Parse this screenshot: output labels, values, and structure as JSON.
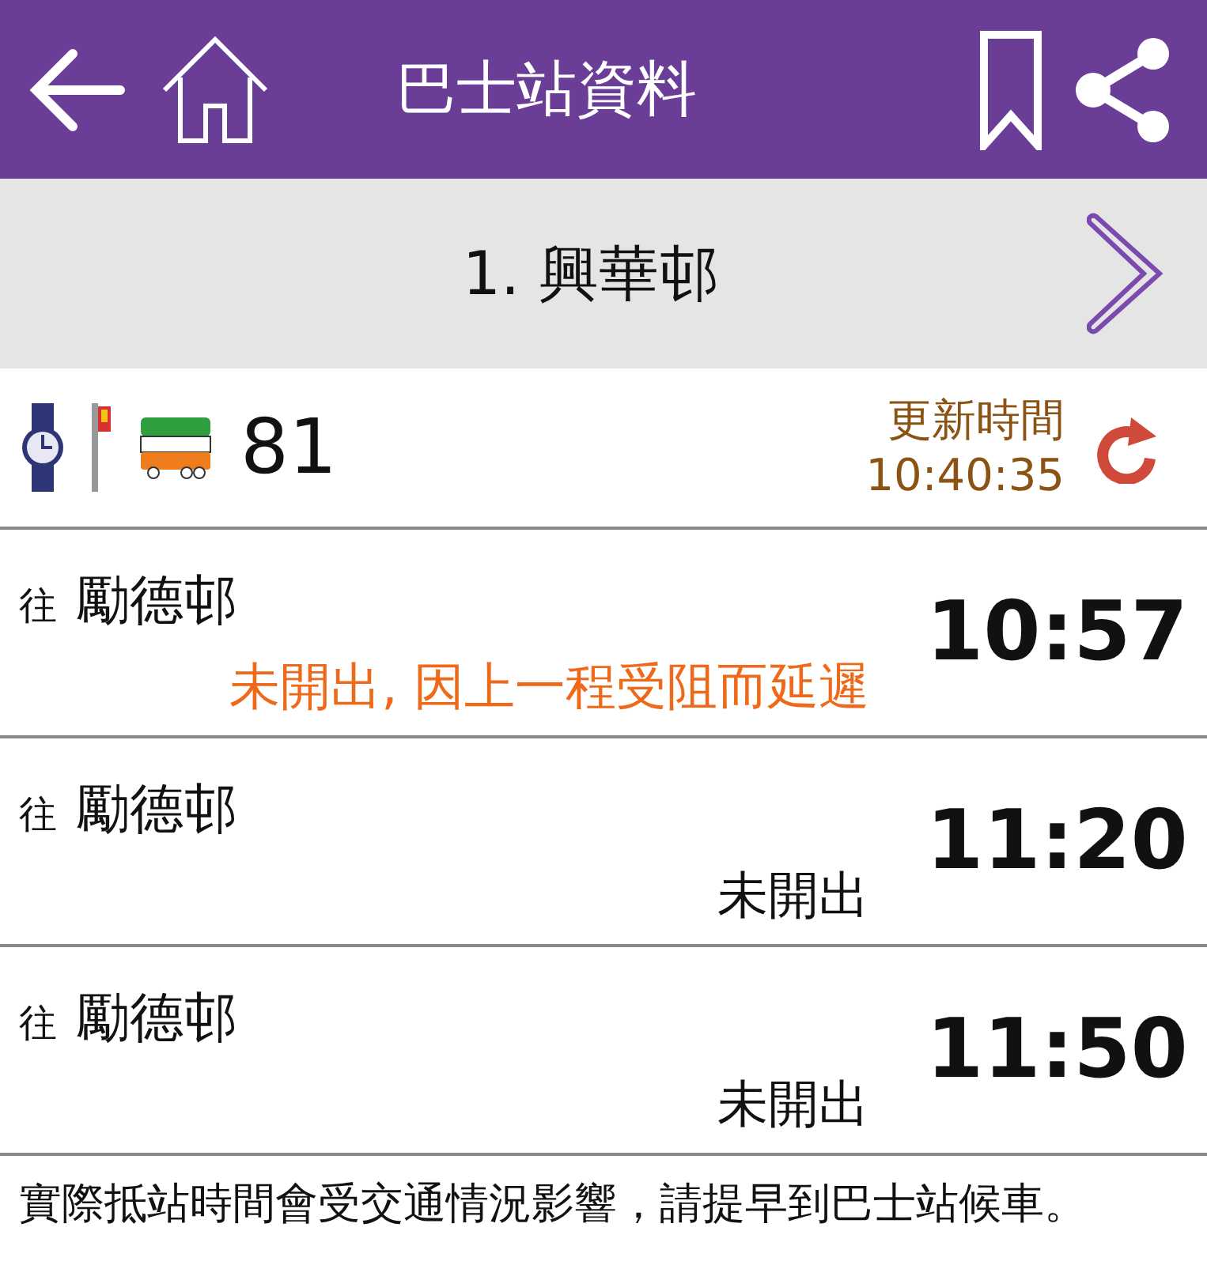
{
  "app_bar": {
    "title": "巴士站資料"
  },
  "stop": {
    "name": "1. 興華邨"
  },
  "route": {
    "number": "81",
    "update_label": "更新時間",
    "update_time": "10:40:35"
  },
  "departures": [
    {
      "prefix": "往",
      "destination": "勵德邨",
      "status": "未開出, 因上一程受阻而延遲",
      "kind": "delayed",
      "time": "10:57"
    },
    {
      "prefix": "往",
      "destination": "勵德邨",
      "status": "未開出",
      "kind": "normal",
      "time": "11:20"
    },
    {
      "prefix": "往",
      "destination": "勵德邨",
      "status": "未開出",
      "kind": "normal",
      "time": "11:50"
    }
  ],
  "footer_note": "實際抵站時間會受交通情況影響，請提早到巴士站候車。"
}
